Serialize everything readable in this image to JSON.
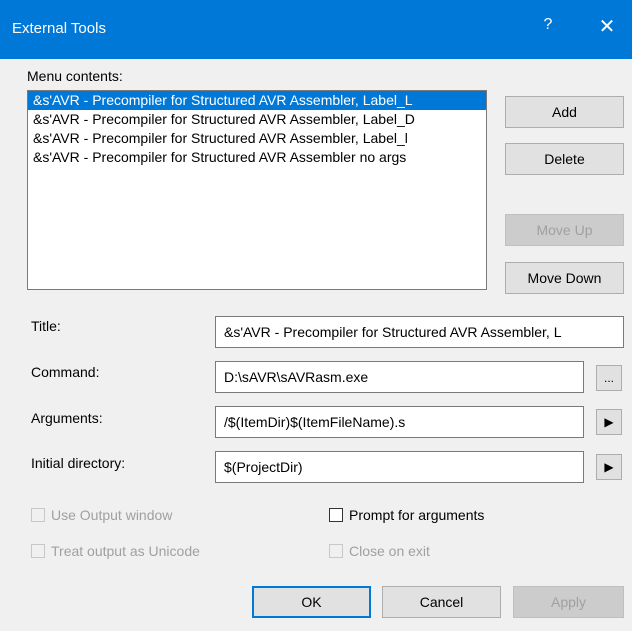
{
  "window": {
    "title": "External Tools",
    "help": "?",
    "close": "✕"
  },
  "menu": {
    "label": "Menu contents:",
    "items": [
      "&s'AVR - Precompiler for Structured AVR Assembler, Label_L",
      "&s'AVR - Precompiler for Structured AVR Assembler, Label_D",
      "&s'AVR - Precompiler for Structured AVR Assembler, Label_l",
      "&s'AVR - Precompiler for Structured AVR Assembler no args"
    ],
    "selected_index": 0
  },
  "side_buttons": {
    "add": "Add",
    "delete": "Delete",
    "move_up": "Move Up",
    "move_down": "Move Down"
  },
  "fields": {
    "title_label": "Title:",
    "title_value": "&s'AVR - Precompiler for Structured AVR Assembler, L",
    "command_label": "Command:",
    "command_value": "D:\\sAVR\\sAVRasm.exe",
    "command_browse": "...",
    "arguments_label": "Arguments:",
    "arguments_value": "/$(ItemDir)$(ItemFileName).s",
    "arguments_menu": "▶",
    "initial_dir_label": "Initial directory:",
    "initial_dir_value": "$(ProjectDir)",
    "initial_dir_menu": "▶"
  },
  "options": {
    "use_output_window": "Use Output window",
    "prompt_for_arguments": "Prompt for arguments",
    "treat_output_unicode": "Treat output as Unicode",
    "close_on_exit": "Close on exit"
  },
  "footer": {
    "ok": "OK",
    "cancel": "Cancel",
    "apply": "Apply"
  },
  "colors": {
    "accent": "#0078d7",
    "background": "#f0f0f0"
  }
}
